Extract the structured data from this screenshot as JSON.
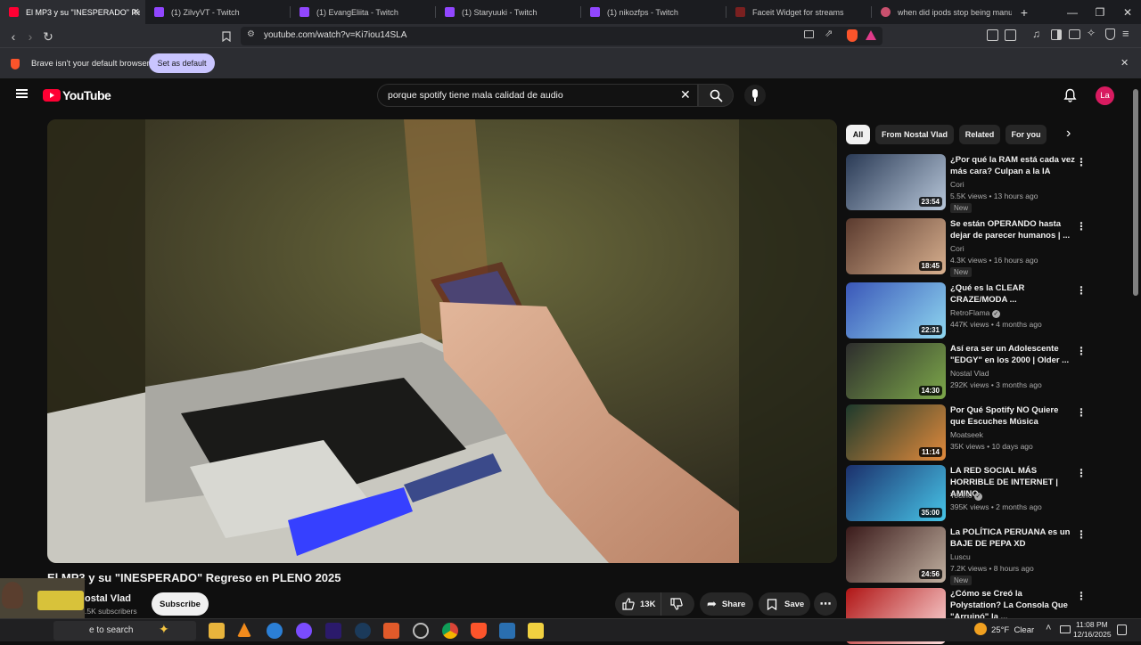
{
  "browser": {
    "tabs": [
      {
        "title": "El MP3 y su \"INESPERADO\" Reg",
        "favicon_color": "#ff0033",
        "active": true
      },
      {
        "title": "(1) ZilvyVT - Twitch",
        "favicon_color": "#9146ff"
      },
      {
        "title": "(1) EvangEliita - Twitch",
        "favicon_color": "#9146ff"
      },
      {
        "title": "(1) Staryuuki - Twitch",
        "favicon_color": "#9146ff"
      },
      {
        "title": "(1) nikozfps - Twitch",
        "favicon_color": "#9146ff"
      },
      {
        "title": "Faceit Widget for streams",
        "favicon_color": "#7a2020"
      },
      {
        "title": "when did ipods stop being manufac",
        "favicon_color": "#c9506e"
      }
    ],
    "new_tab_label": "+",
    "url": "youtube.com/watch?v=Ki7iou14SLA",
    "infobar": {
      "message": "Brave isn't your default browser",
      "button": "Set as default"
    }
  },
  "youtube": {
    "logo_text": "YouTube",
    "search_query": "porque spotify tiene mala calidad de audio",
    "avatar_initials": "La",
    "video": {
      "title": "El MP3 y su \"INESPERADO\" Regreso en PLENO 2025",
      "channel": "Nostal Vlad",
      "channel_display": "ostal Vlad",
      "subscribers": ".5K subscribers",
      "subscribe_label": "Subscribe",
      "likes": "13K",
      "share_label": "Share",
      "save_label": "Save"
    },
    "chips": [
      "All",
      "From Nostal Vlad",
      "Related",
      "For you"
    ],
    "recommendations": [
      {
        "title": "¿Por qué la RAM está cada vez más cara? Culpan a la IA",
        "channel": "Cori",
        "meta": "5.5K views • 13 hours ago",
        "duration": "23:54",
        "badge": "New",
        "c1": "#2a3a55",
        "c2": "#b8c7d9"
      },
      {
        "title": "Se están OPERANDO hasta dejar de parecer humanos | ...",
        "channel": "Cori",
        "meta": "4.3K views • 16 hours ago",
        "duration": "18:45",
        "badge": "New",
        "c1": "#5a3a2e",
        "c2": "#d8b08f"
      },
      {
        "title": "¿Qué es la CLEAR CRAZE/MODA ...",
        "channel": "RetroFlama",
        "verified": true,
        "meta": "447K views • 4 months ago",
        "duration": "22:31",
        "c1": "#3a56b8",
        "c2": "#8fd7f0"
      },
      {
        "title": "Así era ser un Adolescente \"EDGY\" en los 2000 | Older ...",
        "channel": "Nostal Vlad",
        "meta": "292K views • 3 months ago",
        "duration": "14:30",
        "c1": "#2d2d2d",
        "c2": "#7da84a"
      },
      {
        "title": "Por Qué Spotify NO Quiere que Escuches Música",
        "channel": "Moatseek",
        "meta": "35K views • 10 days ago",
        "duration": "11:14",
        "c1": "#1d3a2c",
        "c2": "#e28a3c"
      },
      {
        "title": "LA RED SOCIAL MÁS HORRIBLE DE INTERNET | AMINO",
        "channel": "Tocino",
        "verified": true,
        "meta": "395K views • 2 months ago",
        "duration": "35:00",
        "c1": "#1b2f6b",
        "c2": "#47c5e8"
      },
      {
        "title": "La POLÍTICA PERUANA es un BAJE DE PEPA XD",
        "channel": "Luscu",
        "meta": "7.2K views • 8 hours ago",
        "duration": "24:56",
        "badge": "New",
        "c1": "#3a1a1a",
        "c2": "#c0b0a0"
      },
      {
        "title": "¿Cómo se Creó la Polystation? La Consola Que \"Arruinó\" la ...",
        "channel": "",
        "meta": "",
        "duration": "",
        "c1": "#b01515",
        "c2": "#ffdede"
      }
    ]
  },
  "taskbar": {
    "search_text": "e to search",
    "weather": "25°F  Clear",
    "time": "11:08 PM",
    "date": "12/16/2025"
  },
  "colors": {
    "yt_red": "#ff0033",
    "brave_orange": "#fb542b",
    "twitch_purple": "#9146ff"
  }
}
